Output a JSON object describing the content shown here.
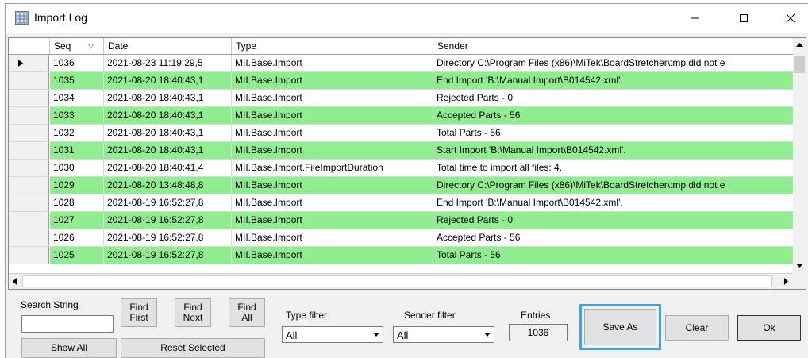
{
  "window": {
    "title": "Import Log"
  },
  "columns": {
    "seq": "Seq",
    "date": "Date",
    "type": "Type",
    "sender": "Sender"
  },
  "rows": [
    {
      "seq": "1036",
      "date": "2021-08-23 11:19:29,5",
      "type": "MII.Base.Import",
      "sender": "Directory C:\\Program Files (x86)\\MiTek\\BoardStretcher\\tmp did not e",
      "green": false,
      "current": true
    },
    {
      "seq": "1035",
      "date": "2021-08-20 18:40:43,1",
      "type": "MII.Base.Import",
      "sender": "End Import 'B:\\Manual Import\\B014542.xml'.",
      "green": true,
      "current": false
    },
    {
      "seq": "1034",
      "date": "2021-08-20 18:40:43,1",
      "type": "MII.Base.Import",
      "sender": "Rejected Parts - 0",
      "green": false,
      "current": false
    },
    {
      "seq": "1033",
      "date": "2021-08-20 18:40:43,1",
      "type": "MII.Base.Import",
      "sender": "Accepted Parts - 56",
      "green": true,
      "current": false
    },
    {
      "seq": "1032",
      "date": "2021-08-20 18:40:43,1",
      "type": "MII.Base.Import",
      "sender": "Total Parts - 56",
      "green": false,
      "current": false
    },
    {
      "seq": "1031",
      "date": "2021-08-20 18:40:43,1",
      "type": "MII.Base.Import",
      "sender": "Start Import 'B:\\Manual Import\\B014542.xml'.",
      "green": true,
      "current": false
    },
    {
      "seq": "1030",
      "date": "2021-08-20 18:40:41,4",
      "type": "MII.Base.Import.FileImportDuration",
      "sender": "Total time to import all files: 4.",
      "green": false,
      "current": false
    },
    {
      "seq": "1029",
      "date": "2021-08-20 13:48:48,8",
      "type": "MII.Base.Import",
      "sender": "Directory C:\\Program Files (x86)\\MiTek\\BoardStretcher\\tmp did not e",
      "green": true,
      "current": false
    },
    {
      "seq": "1028",
      "date": "2021-08-19 16:52:27,8",
      "type": "MII.Base.Import",
      "sender": "End Import 'B:\\Manual Import\\B014542.xml'.",
      "green": false,
      "current": false
    },
    {
      "seq": "1027",
      "date": "2021-08-19 16:52:27,8",
      "type": "MII.Base.Import",
      "sender": "Rejected Parts - 0",
      "green": true,
      "current": false
    },
    {
      "seq": "1026",
      "date": "2021-08-19 16:52:27,8",
      "type": "MII.Base.Import",
      "sender": "Accepted Parts - 56",
      "green": false,
      "current": false
    },
    {
      "seq": "1025",
      "date": "2021-08-19 16:52:27,8",
      "type": "MII.Base.Import",
      "sender": "Total Parts - 56",
      "green": true,
      "current": false
    }
  ],
  "search": {
    "label": "Search String",
    "value": ""
  },
  "buttons": {
    "find_first": [
      "Find",
      "First"
    ],
    "find_next": [
      "Find",
      "Next"
    ],
    "find_all": [
      "Find",
      "All"
    ],
    "show_all": "Show All",
    "reset_selected": "Reset Selected",
    "save_as": "Save As",
    "clear": "Clear",
    "ok": "Ok"
  },
  "type_filter": {
    "label": "Type filter",
    "value": "All"
  },
  "sender_filter": {
    "label": "Sender filter",
    "value": "All"
  },
  "entries": {
    "label": "Entries",
    "value": "1036"
  },
  "colors": {
    "row_highlight": "#90ee90",
    "focus_highlight": "#3ba6dd"
  }
}
